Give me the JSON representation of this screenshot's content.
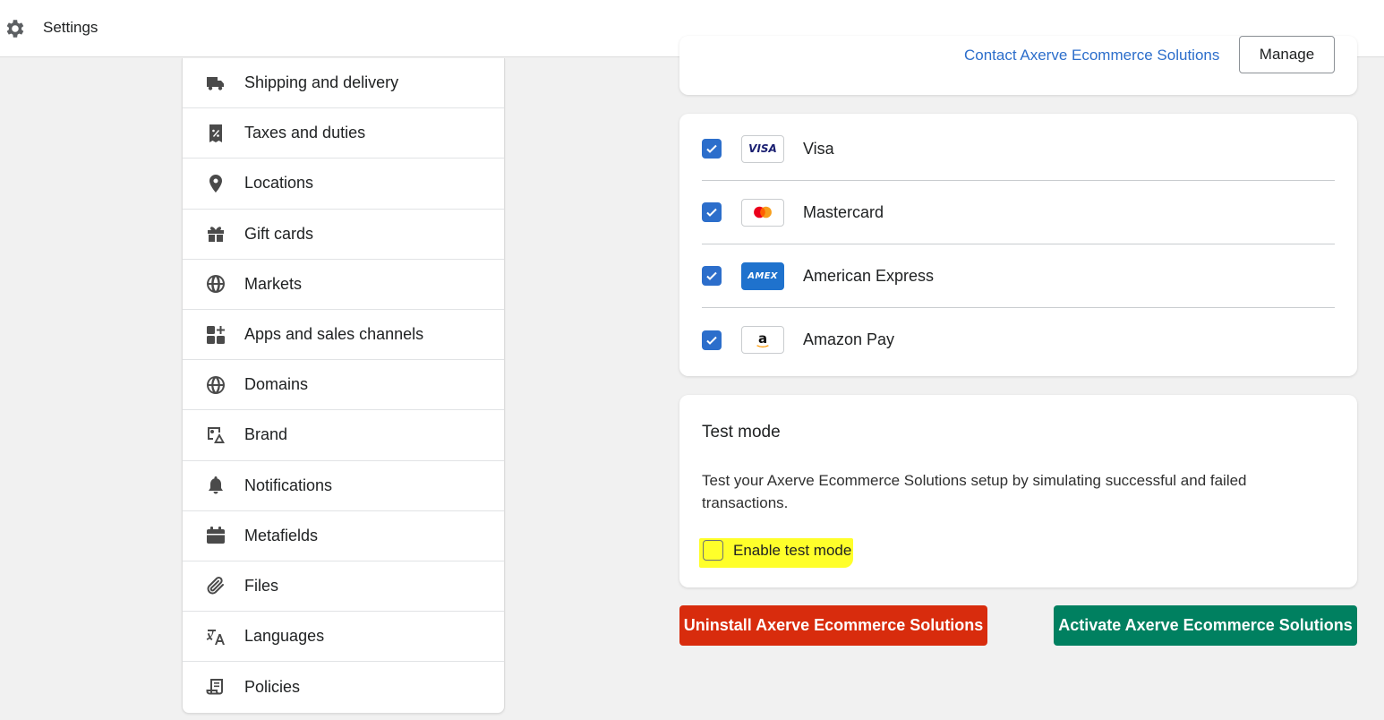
{
  "header": {
    "title": "Settings",
    "icon": "gear-icon"
  },
  "sidebar": {
    "items": [
      {
        "label": "Shipping and delivery",
        "icon": "truck-icon"
      },
      {
        "label": "Taxes and duties",
        "icon": "receipt-percent-icon"
      },
      {
        "label": "Locations",
        "icon": "location-pin-icon"
      },
      {
        "label": "Gift cards",
        "icon": "gift-icon"
      },
      {
        "label": "Markets",
        "icon": "globe-markets-icon"
      },
      {
        "label": "Apps and sales channels",
        "icon": "apps-icon"
      },
      {
        "label": "Domains",
        "icon": "globe-icon"
      },
      {
        "label": "Brand",
        "icon": "brand-icon"
      },
      {
        "label": "Notifications",
        "icon": "bell-icon"
      },
      {
        "label": "Metafields",
        "icon": "metafields-icon"
      },
      {
        "label": "Files",
        "icon": "paperclip-icon"
      },
      {
        "label": "Languages",
        "icon": "translate-icon"
      },
      {
        "label": "Policies",
        "icon": "policy-scroll-icon"
      }
    ]
  },
  "provider": {
    "contact_link": "Contact Axerve Ecommerce Solutions",
    "manage_label": "Manage"
  },
  "payment_methods": [
    {
      "name": "Visa",
      "checked": true,
      "logo_text": "VISA"
    },
    {
      "name": "Mastercard",
      "checked": true,
      "logo_text": ""
    },
    {
      "name": "American Express",
      "checked": true,
      "logo_text": "AMEX"
    },
    {
      "name": "Amazon Pay",
      "checked": true,
      "logo_text": "a"
    }
  ],
  "test_mode": {
    "heading": "Test mode",
    "description": "Test your Axerve Ecommerce Solutions setup by simulating successful and failed transactions.",
    "checkbox_label": "Enable test mode",
    "checked": false
  },
  "actions": {
    "uninstall_label": "Uninstall Axerve Ecommerce Solutions",
    "activate_label": "Activate Axerve Ecommerce Solutions"
  },
  "colors": {
    "accent_blue": "#2c6ecb",
    "uninstall_red": "#d82c0d",
    "activate_green": "#008060",
    "highlight_yellow": "#ffff2a"
  }
}
